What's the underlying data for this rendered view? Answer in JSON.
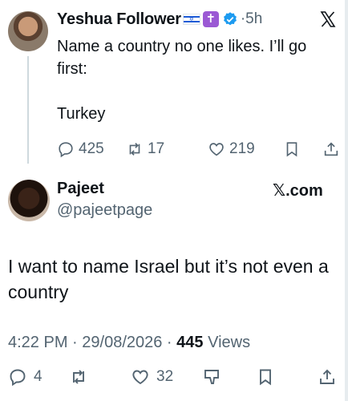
{
  "top_tweet": {
    "author_name": "Yeshua Follower",
    "flag_emoji": "✡",
    "cross_emoji": "✝",
    "time": "5h",
    "text": "Name a country no one likes. I’ll go\nfirst:\n\nTurkey",
    "replies": "425",
    "reposts": "17",
    "likes": "219",
    "icons": [
      "reply-icon",
      "repost-icon",
      "like-icon",
      "bookmark-icon",
      "share-icon",
      "x-logo-icon",
      "verified-badge-icon"
    ]
  },
  "main_tweet": {
    "author_name": "Pajeet",
    "handle": "@pajeetpage",
    "watermark": "𝕏.com",
    "text": "I want to name Israel but it’s not even a country",
    "time": "4:22 PM",
    "date": "29/08/2026",
    "views_count": "445",
    "views_label": "Views",
    "replies": "4",
    "likes": "32",
    "icons": [
      "reply-icon",
      "repost-icon",
      "like-icon",
      "dislike-icon",
      "bookmark-icon",
      "share-icon"
    ]
  },
  "colors": {
    "text": "#0f1419",
    "muted": "#536471",
    "verified": "#1d9bf0",
    "thread_line": "#cfd9de"
  }
}
